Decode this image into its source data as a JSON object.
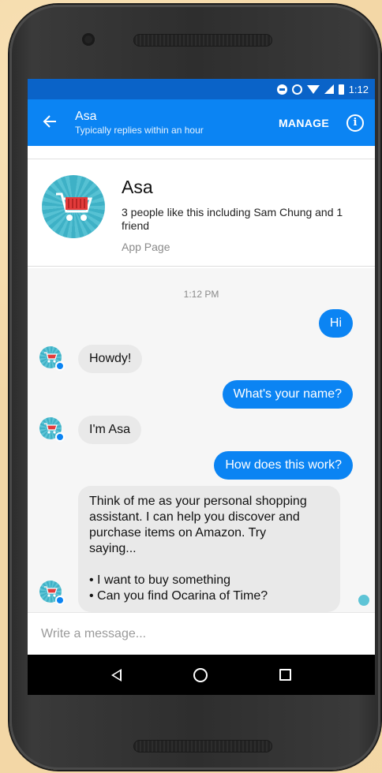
{
  "statusbar": {
    "time": "1:12"
  },
  "appbar": {
    "name": "Asa",
    "subtitle": "Typically replies within an hour",
    "manage_label": "MANAGE",
    "info_glyph": "i"
  },
  "profile": {
    "name": "Asa",
    "likes": "3 people like this including Sam Chung and 1 friend",
    "type": "App Page"
  },
  "chat": {
    "timestamp": "1:12 PM",
    "messages": [
      {
        "from": "me",
        "text": "Hi"
      },
      {
        "from": "bot",
        "text": "Howdy!"
      },
      {
        "from": "me",
        "text": "What's your name?"
      },
      {
        "from": "bot",
        "text": "I'm Asa"
      },
      {
        "from": "me",
        "text": "How does this work?"
      },
      {
        "from": "bot",
        "lines": [
          "Think of me as your personal shopping",
          "assistant. I can help you discover and",
          "purchase items on Amazon. Try",
          "saying...",
          "",
          "• I want to buy something",
          "• Can you find Ocarina of Time?"
        ]
      }
    ]
  },
  "composer": {
    "placeholder": "Write a message..."
  },
  "colors": {
    "brand": "#0b84f3",
    "statusbar": "#0a63c8",
    "bot_bubble": "#e9e9e9",
    "chat_bg": "#f6f6f6"
  },
  "icons": [
    "back-arrow-icon",
    "info-icon",
    "cart-avatar-icon",
    "messenger-badge-icon",
    "nav-back-icon",
    "nav-home-icon",
    "nav-recents-icon"
  ]
}
